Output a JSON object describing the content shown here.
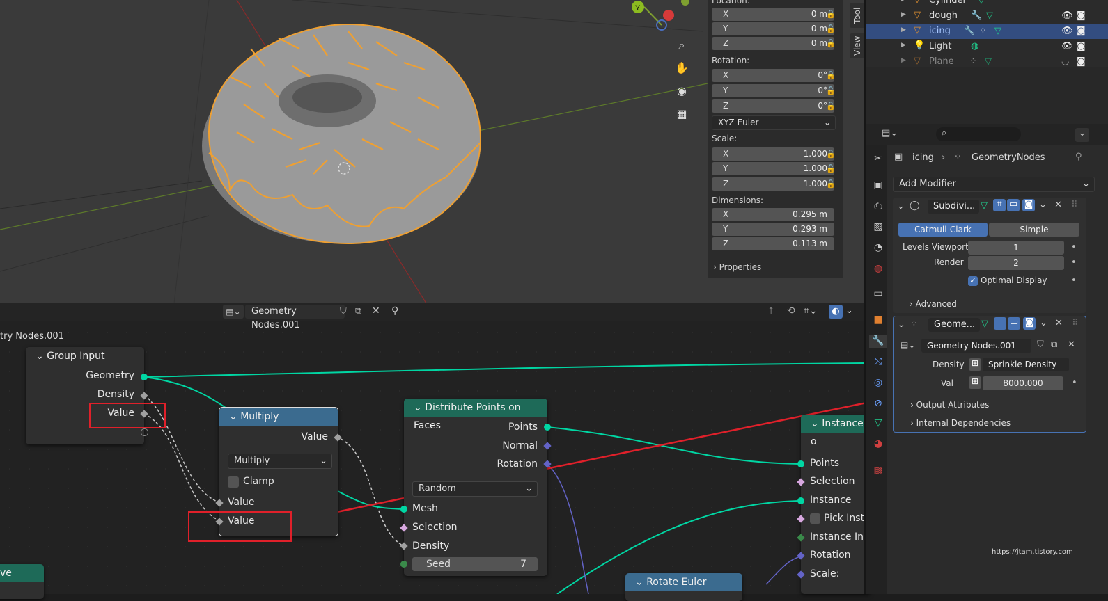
{
  "viewport": {
    "gizmo_y": "Y",
    "tabs": [
      "Tool",
      "View"
    ],
    "location_label": "Location:",
    "location": [
      {
        "axis": "X",
        "value": "0 m"
      },
      {
        "axis": "Y",
        "value": "0 m"
      },
      {
        "axis": "Z",
        "value": "0 m"
      }
    ],
    "rotation_label": "Rotation:",
    "rotation": [
      {
        "axis": "X",
        "value": "0°"
      },
      {
        "axis": "Y",
        "value": "0°"
      },
      {
        "axis": "Z",
        "value": "0°"
      }
    ],
    "rotation_mode": "XYZ Euler",
    "scale_label": "Scale:",
    "scale": [
      {
        "axis": "X",
        "value": "1.000"
      },
      {
        "axis": "Y",
        "value": "1.000"
      },
      {
        "axis": "Z",
        "value": "1.000"
      }
    ],
    "dimensions_label": "Dimensions:",
    "dimensions": [
      {
        "axis": "X",
        "value": "0.295 m"
      },
      {
        "axis": "Y",
        "value": "0.293 m"
      },
      {
        "axis": "Z",
        "value": "0.113 m"
      }
    ],
    "properties_label": "Properties"
  },
  "outliner": {
    "items": [
      {
        "name": "Cylinder",
        "dim": false
      },
      {
        "name": "dough",
        "dim": false
      },
      {
        "name": "icing",
        "dim": false,
        "selected": true
      },
      {
        "name": "Light",
        "dim": false
      },
      {
        "name": "Plane",
        "dim": true
      }
    ]
  },
  "node_editor": {
    "header_tree": "Geometry Nodes.001",
    "breadcrumb": "try Nodes.001",
    "group_input": {
      "title": "Group Input",
      "outputs": [
        "Geometry",
        "Density",
        "Value"
      ]
    },
    "multiply": {
      "title": "Multiply",
      "output": "Value",
      "operation": "Multiply",
      "clamp": "Clamp",
      "inputs": [
        "Value",
        "Value"
      ]
    },
    "distribute": {
      "title": "Distribute Points on Faces",
      "outputs": [
        "Points",
        "Normal",
        "Rotation"
      ],
      "mode": "Random",
      "inputs": [
        "Mesh",
        "Selection",
        "Density"
      ],
      "seed_label": "Seed",
      "seed_value": "7"
    },
    "instance": {
      "title": "Instance o",
      "inputs": [
        "Points",
        "Selection",
        "Instance",
        "Pick Insta",
        "Instance Ind",
        "Rotation",
        "Scale:"
      ]
    },
    "rotate_euler": {
      "title": "Rotate Euler"
    },
    "curve_node": {
      "title": "ve"
    }
  },
  "properties": {
    "object_name": "icing",
    "modifier_name": "GeometryNodes",
    "add_modifier": "Add Modifier",
    "subdiv": {
      "name": "Subdivi...",
      "modes": [
        "Catmull-Clark",
        "Simple"
      ],
      "levels_viewport_label": "Levels Viewport",
      "levels_viewport": "1",
      "render_label": "Render",
      "render": "2",
      "optimal_display": "Optimal Display",
      "advanced": "Advanced"
    },
    "geonodes": {
      "name": "Geome...",
      "tree": "Geometry Nodes.001",
      "density_label": "Density",
      "density_attr": "Sprinkle Density",
      "value_label": "Val",
      "value": "8000.000",
      "output_attrs": "Output Attributes",
      "internal_deps": "Internal Dependencies"
    },
    "watermark": "https://jtam.tistory.com"
  },
  "colors": {
    "accent": "#4772b3",
    "geometry": "#00d6a3",
    "selection": "#e0e0e0",
    "annotation": "#e0202a",
    "vector": "#6363c7"
  }
}
